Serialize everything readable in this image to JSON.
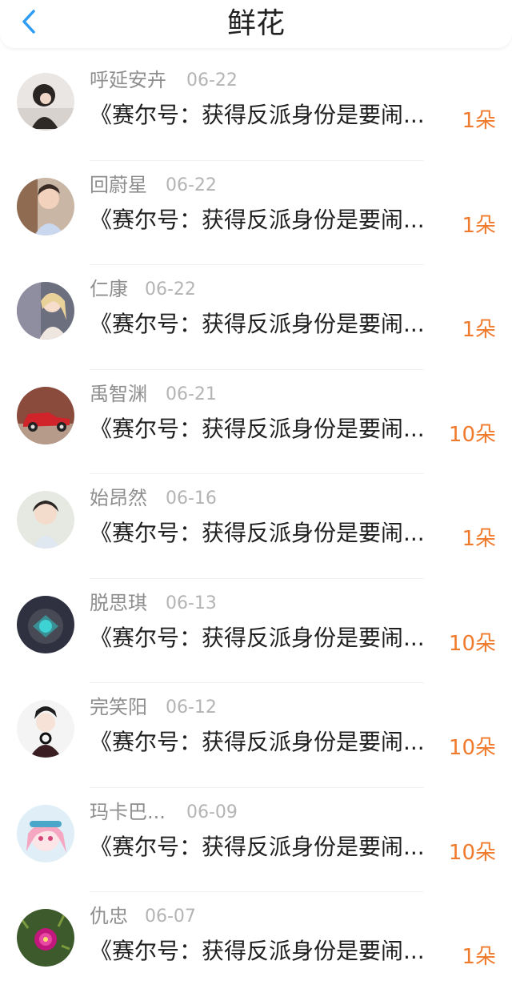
{
  "header": {
    "title": "鲜花",
    "back_icon": "chevron-left-icon",
    "accent": "#2f9cf3"
  },
  "colors": {
    "count": "#f07a2c",
    "name": "#8e8e8e",
    "date": "#b4b4b4",
    "text": "#1f1f1f"
  },
  "items": [
    {
      "name": "呼延安卉",
      "date": "06-22",
      "text": "《赛尔号：获得反派身份是要闹...",
      "count": "1朵"
    },
    {
      "name": "回蔚星",
      "date": "06-22",
      "text": "《赛尔号：获得反派身份是要闹...",
      "count": "1朵"
    },
    {
      "name": "仁康",
      "date": "06-22",
      "text": "《赛尔号：获得反派身份是要闹...",
      "count": "1朵"
    },
    {
      "name": "禹智渊",
      "date": "06-21",
      "text": "《赛尔号：获得反派身份是要闹...",
      "count": "10朵"
    },
    {
      "name": "始昂然",
      "date": "06-16",
      "text": "《赛尔号：获得反派身份是要闹...",
      "count": "1朵"
    },
    {
      "name": "脱思琪",
      "date": "06-13",
      "text": "《赛尔号：获得反派身份是要闹...",
      "count": "10朵"
    },
    {
      "name": "完笑阳",
      "date": "06-12",
      "text": "《赛尔号：获得反派身份是要闹...",
      "count": "10朵"
    },
    {
      "name": "玛卡巴...",
      "date": "06-09",
      "text": "《赛尔号：获得反派身份是要闹...",
      "count": "10朵"
    },
    {
      "name": "仇忠",
      "date": "06-07",
      "text": "《赛尔号：获得反派身份是要闹...",
      "count": "1朵"
    }
  ]
}
